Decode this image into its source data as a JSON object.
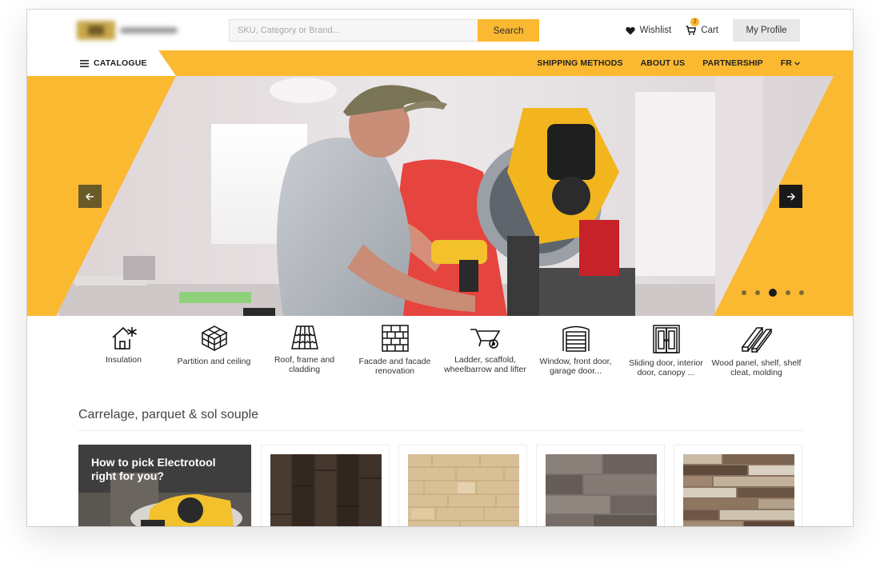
{
  "header": {
    "search_placeholder": "SKU, Category or Brand...",
    "search_button": "Search",
    "wishlist": "Wishlist",
    "cart": "Cart",
    "cart_count": "2",
    "profile": "My Profile"
  },
  "nav": {
    "catalogue": "CATALOGUE",
    "links": [
      "SHIPPING METHODS",
      "ABOUT US",
      "PARTNERSHIP"
    ],
    "language": "FR"
  },
  "hero": {
    "slide_count": 5,
    "active_slide": 3
  },
  "categories": [
    {
      "label": "Insulation",
      "icon": "house-insulation-icon"
    },
    {
      "label": "Partition and ceiling",
      "icon": "cube-grid-icon"
    },
    {
      "label": "Roof, frame and cladding",
      "icon": "roof-tiles-icon"
    },
    {
      "label": "Facade and facade renovation",
      "icon": "brick-wall-icon"
    },
    {
      "label": "Ladder, scaffold, wheelbarrow and lifter",
      "icon": "wheelbarrow-icon"
    },
    {
      "label": "Window, front door, garage door...",
      "icon": "garage-door-icon"
    },
    {
      "label": "Sliding door, interior door, canopy ...",
      "icon": "double-door-icon"
    },
    {
      "label": "Wood panel, shelf, shelf cleat, molding",
      "icon": "wood-planks-icon"
    }
  ],
  "section": {
    "title": "Carrelage, parquet & sol souple",
    "promo_title": "How to pick Electrotool right for you?"
  },
  "colors": {
    "accent": "#fbb931",
    "dark": "#1a1a1a"
  }
}
